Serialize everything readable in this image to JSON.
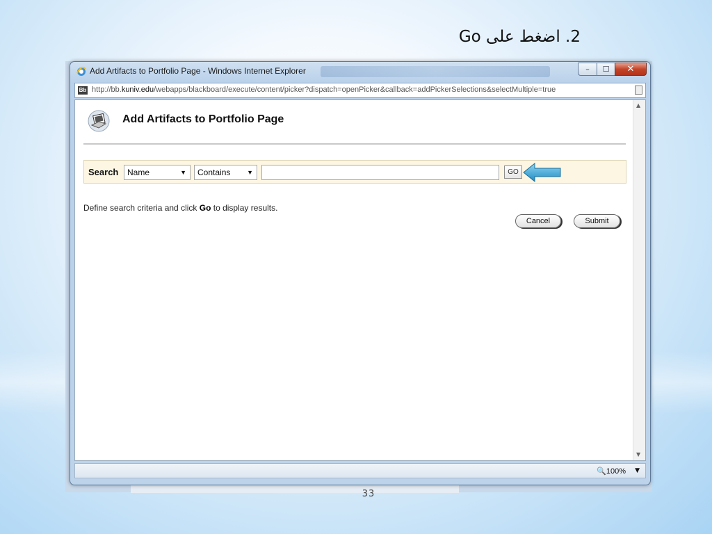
{
  "slide": {
    "title": "2. اضغط على Go",
    "page_number": "33"
  },
  "window": {
    "title": "Add Artifacts to Portfolio Page - Windows Internet Explorer",
    "controls": {
      "minimize": "–",
      "maximize": "☐",
      "close": "✕"
    }
  },
  "address": {
    "prefix": "http://bb.",
    "host": "kuniv.edu",
    "path": "/webapps/blackboard/execute/content/picker?dispatch=openPicker&callback=addPickerSelections&selectMultiple=true"
  },
  "page": {
    "title": "Add Artifacts to Portfolio Page"
  },
  "search": {
    "label": "Search",
    "field_selected": "Name",
    "operator_selected": "Contains",
    "value": "",
    "go_label": "GO"
  },
  "hint": {
    "before": "Define search criteria and click ",
    "bold": "Go",
    "after": " to display results."
  },
  "actions": {
    "cancel": "Cancel",
    "submit": "Submit"
  },
  "status": {
    "zoom": "100%"
  },
  "colors": {
    "search_bar_bg": "#fdf6e3",
    "arrow_blue": "#3fa9d8",
    "close_red": "#c44428"
  }
}
